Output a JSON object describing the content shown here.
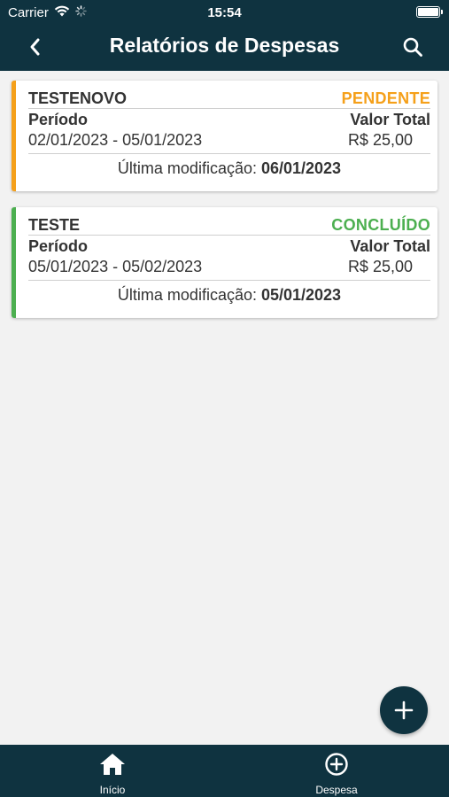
{
  "status_bar": {
    "carrier": "Carrier",
    "time": "15:54"
  },
  "nav": {
    "title": "Relatórios de Despesas"
  },
  "reports": [
    {
      "name": "TESTENOVO",
      "status": "PENDENTE",
      "status_color": "#f5a01a",
      "period_label": "Período",
      "period": "02/01/2023 - 05/01/2023",
      "total_label": "Valor Total",
      "total": "R$ 25,00",
      "modified_label": "Última modificação:",
      "modified": "06/01/2023"
    },
    {
      "name": "TESTE",
      "status": "CONCLUÍDO",
      "status_color": "#4caf50",
      "period_label": "Período",
      "period": "05/01/2023 - 05/02/2023",
      "total_label": "Valor Total",
      "total": "R$ 25,00",
      "modified_label": "Última modificação:",
      "modified": "05/01/2023"
    }
  ],
  "tabs": {
    "home": "Início",
    "expense": "Despesa"
  },
  "colors": {
    "primary": "#0f3340",
    "pending": "#f5a01a",
    "done": "#4caf50",
    "background": "#f2f2f2"
  }
}
